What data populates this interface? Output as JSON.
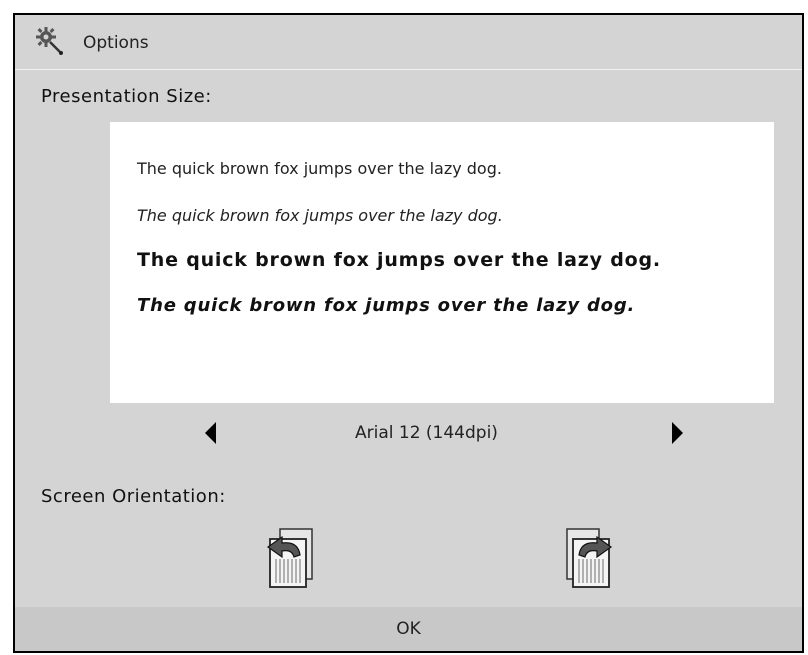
{
  "window": {
    "title": "Options",
    "app_icon": "gear-wand-icon"
  },
  "presentation": {
    "label": "Presentation Size:",
    "samples": [
      "The quick brown fox jumps over the lazy dog.",
      "The quick brown fox jumps over the lazy dog.",
      "The quick brown fox jumps over the lazy dog.",
      "The quick brown fox jumps over the lazy dog."
    ],
    "font_setting": "Arial 12 (144dpi)",
    "prev_icon": "left-triangle-icon",
    "next_icon": "right-triangle-icon"
  },
  "orientation": {
    "label": "Screen Orientation:",
    "rotate_left_icon": "rotate-left-icon",
    "rotate_right_icon": "rotate-right-icon"
  },
  "footer": {
    "ok_label": "OK"
  },
  "colors": {
    "background": "#d4d4d4",
    "preview_background": "#ffffff",
    "footer_background": "#c8c8c8",
    "border": "#000000"
  }
}
